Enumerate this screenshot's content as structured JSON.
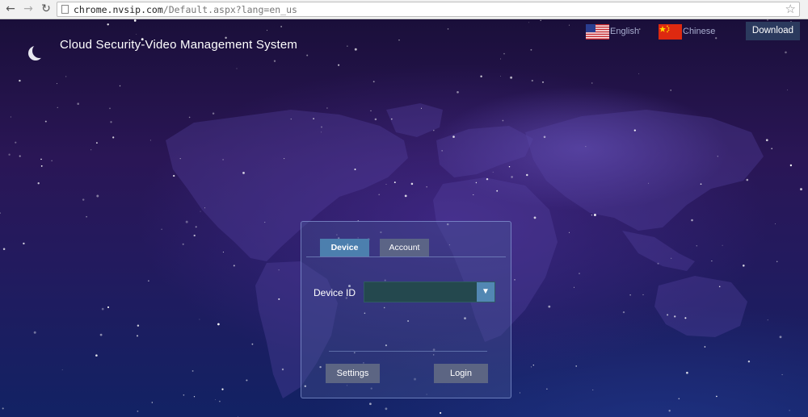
{
  "browser": {
    "url_host": "chrome.nvsip.com",
    "url_path": "/Default.aspx?lang=en_us"
  },
  "header": {
    "title": "Cloud Security-Video Management System",
    "languages": [
      {
        "label": "English",
        "flag": "us-flag-icon"
      },
      {
        "label": "Chinese",
        "flag": "cn-flag-icon"
      }
    ],
    "download_label": "Download"
  },
  "login": {
    "tabs": [
      {
        "label": "Device",
        "active": true
      },
      {
        "label": "Account",
        "active": false
      }
    ],
    "device_id_label": "Device ID",
    "device_id_value": "",
    "settings_label": "Settings",
    "login_label": "Login"
  },
  "colors": {
    "background_top": "#1a0f3a",
    "background_bottom": "#122264",
    "active_tab": "#4c7fae",
    "button": "#5c6583",
    "download_button": "#2b3a5e"
  }
}
